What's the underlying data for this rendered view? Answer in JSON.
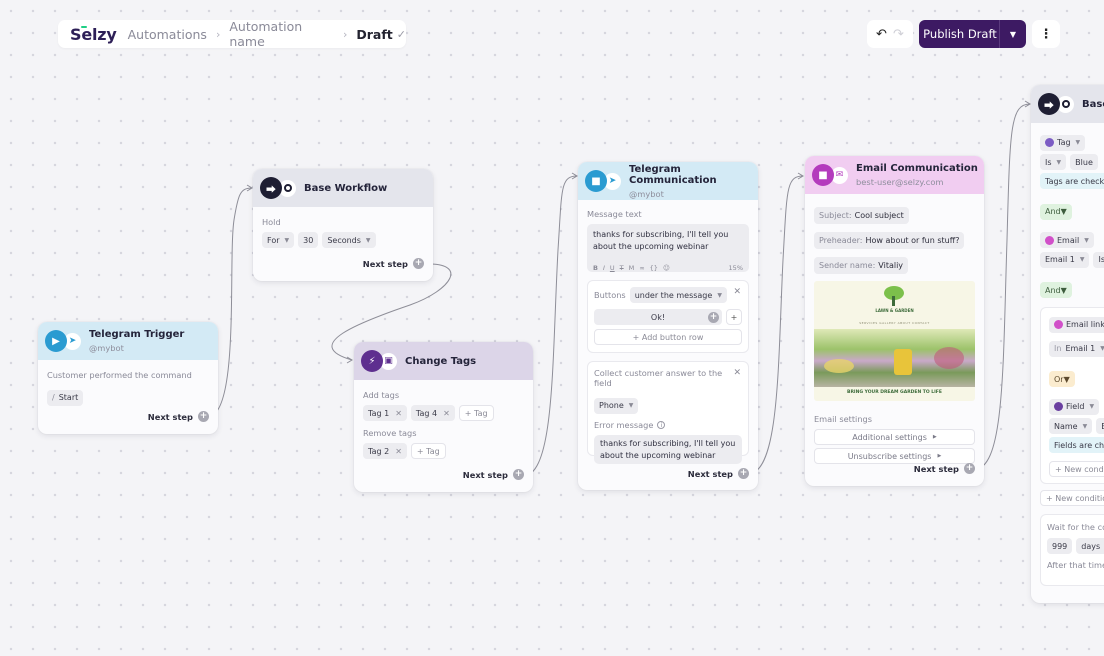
{
  "header": {
    "logo": "Selzy",
    "breadcrumb": [
      "Automations",
      "Automation name"
    ],
    "current": "Draft",
    "status_icon": "check-icon",
    "undo_icon": "undo-icon",
    "redo_icon": "redo-icon",
    "publish_label": "Publish Draft",
    "publish_menu_icon": "chevron-down-icon",
    "more_icon": "more-vertical-icon"
  },
  "colors": {
    "accent": "#3d1a63",
    "telegram_header": "#d3eaf5",
    "workflow_header": "#e4e5ec",
    "tags_header": "#dcd5e8",
    "email_header": "#f1cdf1",
    "canvas": "#f4f4f7"
  },
  "nodes": {
    "telegram_trigger": {
      "title": "Telegram Trigger",
      "subtitle": "@mybot",
      "label": "Customer performed the command",
      "command": "Start",
      "command_prefix": "/",
      "next": "Next step"
    },
    "base_workflow": {
      "title": "Base Workflow",
      "label": "Hold",
      "mode": "For",
      "amount": "30",
      "unit": "Seconds",
      "next": "Next step"
    },
    "change_tags": {
      "title": "Change Tags",
      "add_label": "Add tags",
      "add_tags": [
        "Tag 1",
        "Tag 4"
      ],
      "remove_label": "Remove tags",
      "remove_tags": [
        "Tag 2"
      ],
      "add_tag_button": "+ Tag",
      "next": "Next step"
    },
    "telegram_comm": {
      "title": "Telegram Communication",
      "subtitle": "@mybot",
      "message_label": "Message text",
      "message": "thanks for subscribing, I'll tell you about the upcoming webinar",
      "format_tools": [
        "B",
        "I",
        "U",
        "S",
        "M",
        "link",
        "{ }",
        "emoji"
      ],
      "char_usage": "15%",
      "buttons_label": "Buttons",
      "buttons_position": "under the message",
      "button_text": "Ok!",
      "add_button_row": "+ Add button row",
      "collect_label": "Collect customer answer to the field",
      "collect_field": "Phone",
      "error_label": "Error message",
      "error_message": "thanks for subscribing, I'll tell you about the upcoming webinar",
      "next": "Next step"
    },
    "email_comm": {
      "title": "Email Communication",
      "subtitle": "best-user@selzy.com",
      "subject_label": "Subject:",
      "subject": "Cool subject",
      "preheader_label": "Preheader:",
      "preheader": "How about or fun stuff?",
      "sender_label": "Sender name:",
      "sender": "Vitaliy",
      "preview_brand": "LAWN & GARDEN",
      "preview_nav": "SERVICES  GALLERY  ABOUT  CONTACT",
      "preview_tagline": "BRING YOUR DREAM GARDEN TO LIFE",
      "settings_label": "Email settings",
      "additional_settings": "Additional settings",
      "unsubscribe_settings": "Unsubscribe settings",
      "next": "Next step"
    },
    "base_condition": {
      "title": "Base",
      "cond1_type": "Tag",
      "cond1_op": "Is",
      "cond1_value": "Blue",
      "cond1_note": "Tags are checked",
      "and1": "And",
      "cond2_type": "Email",
      "cond2_email": "Email 1",
      "cond2_op": "Is",
      "and2": "And",
      "group_type": "Email links",
      "group_in": "In",
      "group_email": "Email 1",
      "or": "Or",
      "field_type": "Field",
      "field_name": "Name",
      "field_op": "Eq",
      "field_note": "Fields are checked",
      "new_condition_inner": "+ New condition",
      "new_condition": "+ New condition",
      "wait_text": "Wait for the conditions to be fulfilled for",
      "wait_amount": "999",
      "wait_unit": "days",
      "after_text": "After that time"
    }
  }
}
